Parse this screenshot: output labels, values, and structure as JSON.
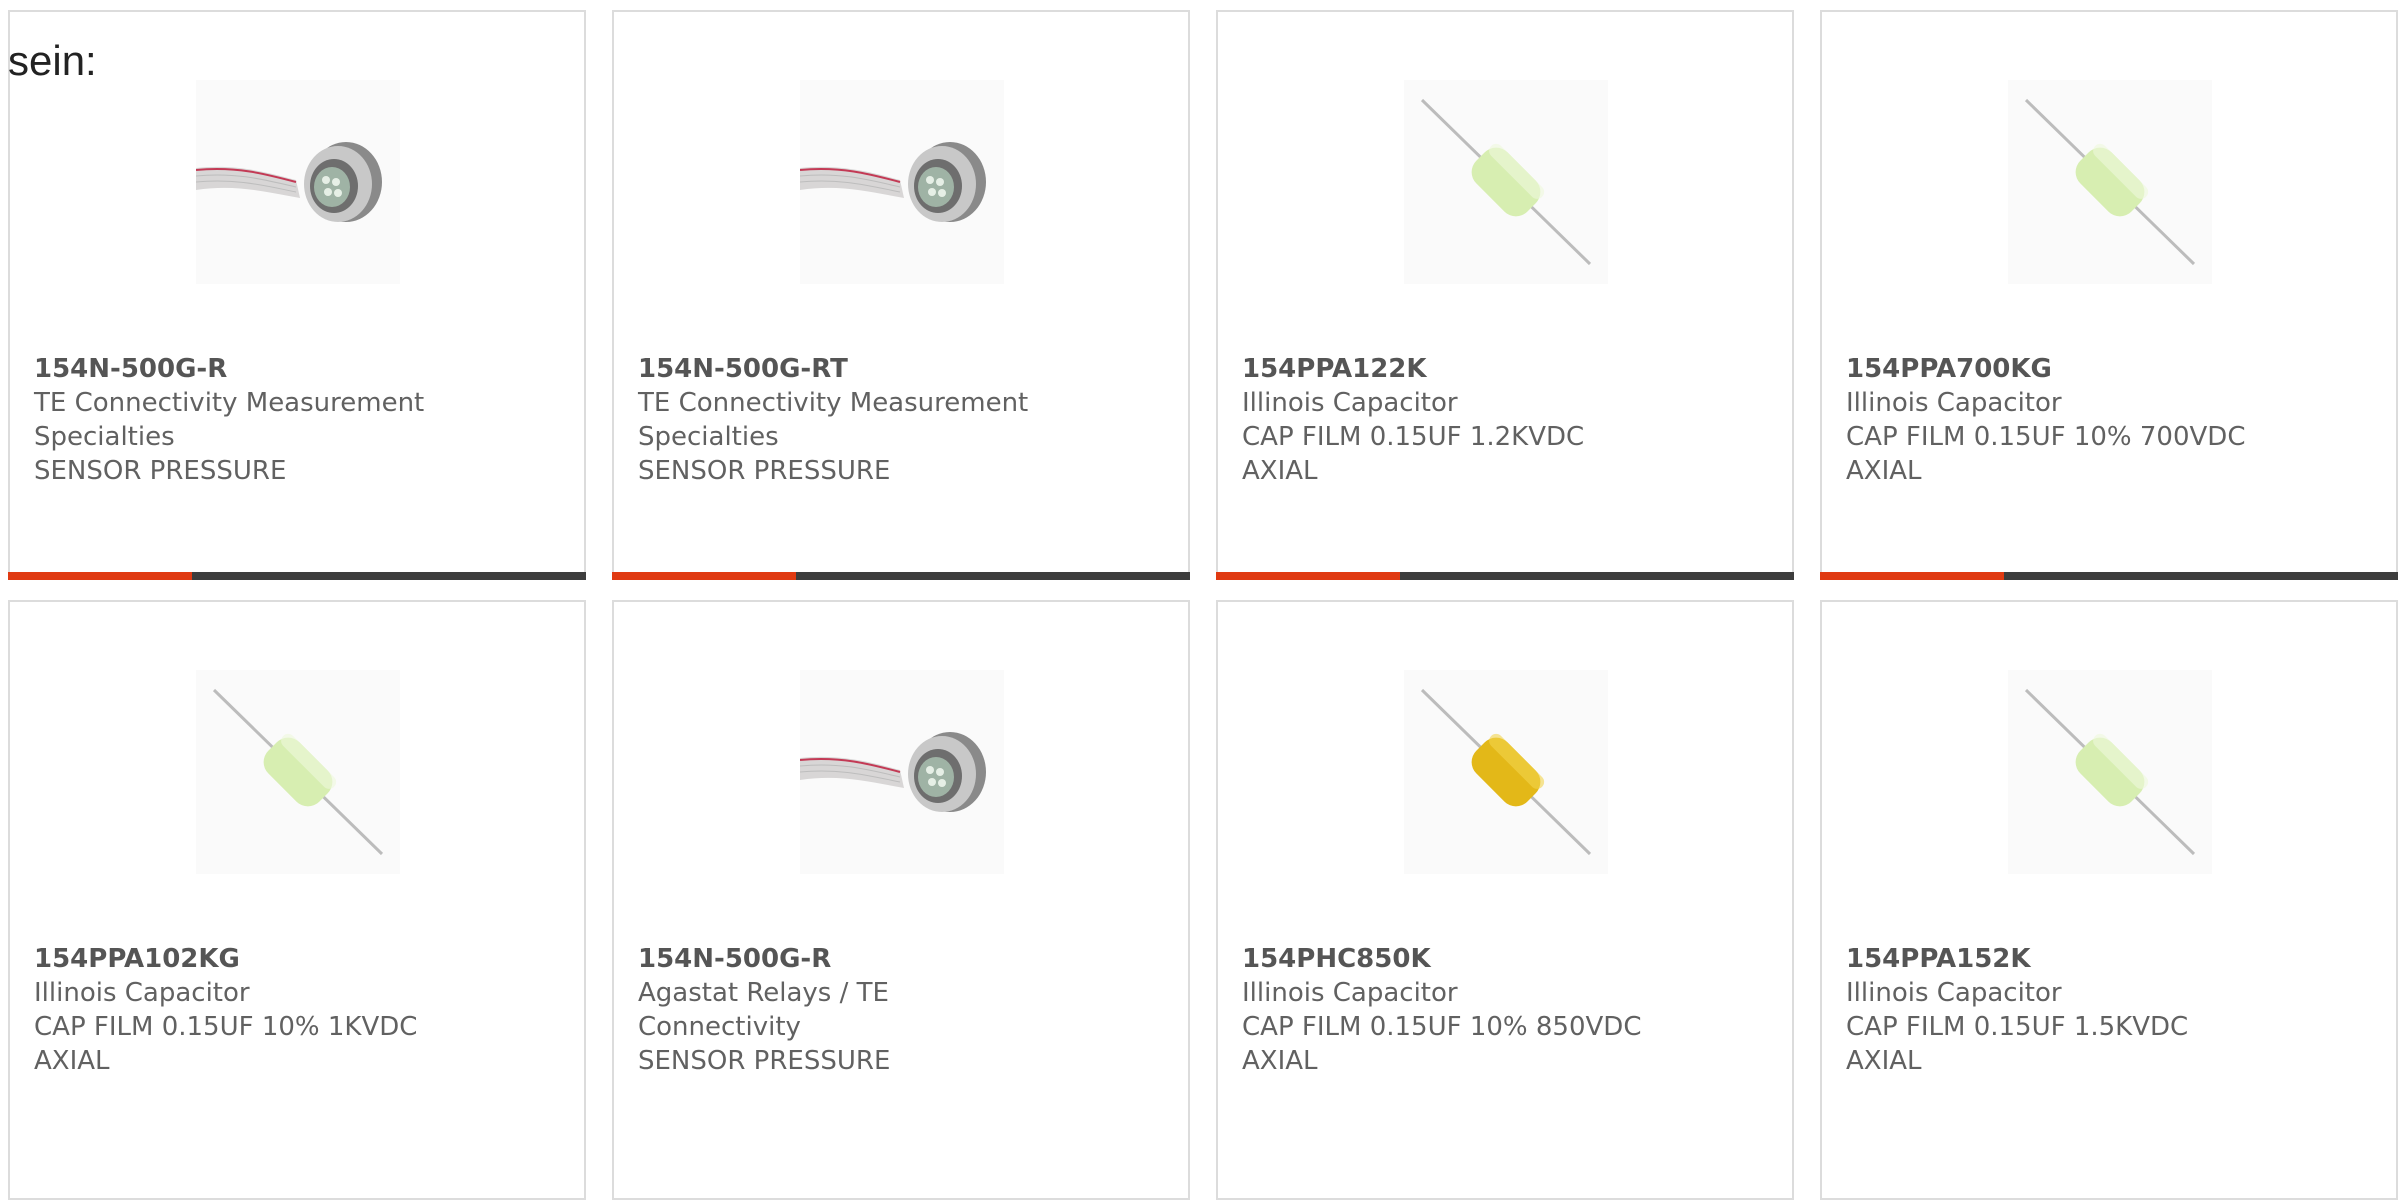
{
  "intro_text": "sein:",
  "colors": {
    "accent": "#e03a12",
    "bar": "#3d3d3d",
    "border": "#dcdcdc",
    "text": "#616161"
  },
  "products": [
    {
      "part_number": "154N-500G-R",
      "manufacturer_lines": [
        "TE Connectivity Measurement",
        "Specialties"
      ],
      "description_lines": [
        "SENSOR PRESSURE"
      ],
      "image_icon": "pressure-sensor-image"
    },
    {
      "part_number": "154N-500G-RT",
      "manufacturer_lines": [
        "TE Connectivity Measurement",
        "Specialties"
      ],
      "description_lines": [
        "SENSOR PRESSURE"
      ],
      "image_icon": "pressure-sensor-image"
    },
    {
      "part_number": "154PPA122K",
      "manufacturer_lines": [
        "Illinois Capacitor"
      ],
      "description_lines": [
        "CAP FILM 0.15UF 1.2KVDC AXIAL"
      ],
      "image_icon": "green-capacitor-image"
    },
    {
      "part_number": "154PPA700KG",
      "manufacturer_lines": [
        "Illinois Capacitor"
      ],
      "description_lines": [
        "CAP FILM 0.15UF 10% 700VDC",
        "AXIAL"
      ],
      "image_icon": "green-capacitor-image"
    },
    {
      "part_number": "154PPA102KG",
      "manufacturer_lines": [
        "Illinois Capacitor"
      ],
      "description_lines": [
        "CAP FILM 0.15UF 10% 1KVDC",
        "AXIAL"
      ],
      "image_icon": "green-capacitor-image"
    },
    {
      "part_number": "154N-500G-R",
      "manufacturer_lines": [
        "Agastat Relays / TE Connectivity"
      ],
      "description_lines": [
        "SENSOR PRESSURE"
      ],
      "image_icon": "pressure-sensor-image"
    },
    {
      "part_number": "154PHC850K",
      "manufacturer_lines": [
        "Illinois Capacitor"
      ],
      "description_lines": [
        "CAP FILM 0.15UF 10% 850VDC",
        "AXIAL"
      ],
      "image_icon": "yellow-capacitor-image"
    },
    {
      "part_number": "154PPA152K",
      "manufacturer_lines": [
        "Illinois Capacitor"
      ],
      "description_lines": [
        "CAP FILM 0.15UF 1.5KVDC AXIAL"
      ],
      "image_icon": "green-capacitor-image"
    }
  ]
}
